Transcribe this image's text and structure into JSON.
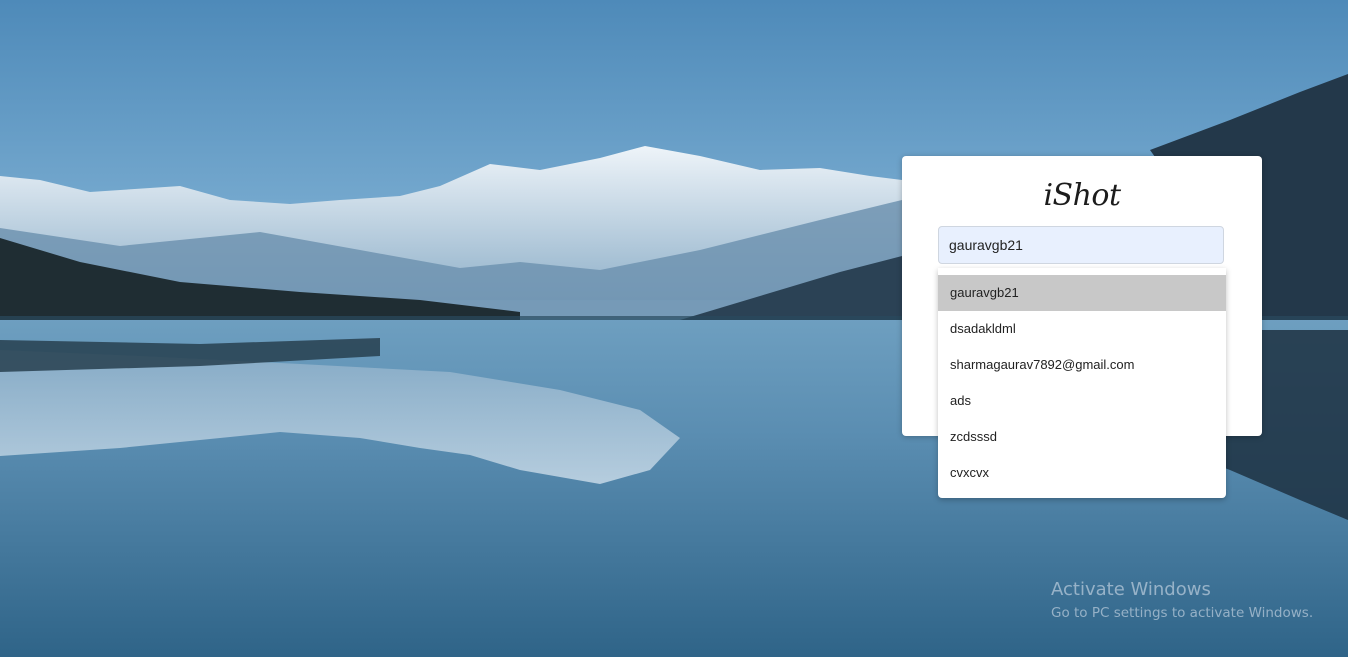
{
  "app": {
    "brand": "iShot"
  },
  "login": {
    "username_value": "gauravgb21"
  },
  "autocomplete": {
    "selected_index": 0,
    "items": [
      "gauravgb21",
      "dsadakldml",
      "sharmagaurav7892@gmail.com",
      "ads",
      "zcdsssd",
      "cvxcvx"
    ]
  },
  "watermark": {
    "title": "Activate Windows",
    "subtitle": "Go to PC settings to activate Windows."
  },
  "colors": {
    "input_autofill_bg": "#e8f0fe",
    "selected_item_bg": "#c8c8c8",
    "sky_top": "#4a86b8",
    "lake": "#3b6f93"
  }
}
